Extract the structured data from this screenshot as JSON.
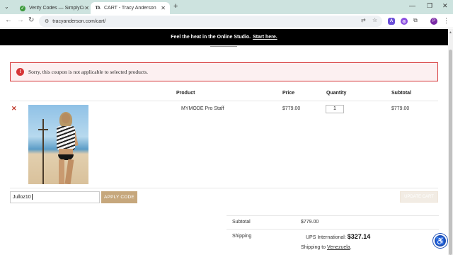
{
  "browser": {
    "tabs": [
      {
        "title": "Verify Codes — SimplyCodes",
        "active": false
      },
      {
        "title": "CART - Tracy Anderson",
        "active": true
      }
    ],
    "url": "tracyanderson.com/cart/",
    "profile_initial": "P"
  },
  "promo": {
    "text": "Feel the heat in the Online Studio.",
    "link": "Start here."
  },
  "notice": {
    "message": "Sorry, this coupon is not applicable to selected products."
  },
  "cart": {
    "headers": {
      "product": "Product",
      "price": "Price",
      "quantity": "Quantity",
      "subtotal": "Subtotal"
    },
    "items": [
      {
        "name": "MYMODE Pro Staff",
        "price": "$779.00",
        "quantity": "1",
        "subtotal": "$779.00"
      }
    ]
  },
  "coupon": {
    "value": "Julloz10",
    "apply_label": "APPLY CODE",
    "update_label": "UPDATE CART"
  },
  "totals": {
    "subtotal_label": "Subtotal",
    "subtotal_value": "$779.00",
    "shipping_label": "Shipping",
    "shipping_method": "UPS International:",
    "shipping_value": "$327.14",
    "shipping_to_prefix": "Shipping to",
    "shipping_to_country": "Venezuela"
  },
  "colors": {
    "promo_bg": "#000000",
    "error": "#d63638",
    "button": "#c6a77c",
    "tabstrip": "#cde3df"
  }
}
